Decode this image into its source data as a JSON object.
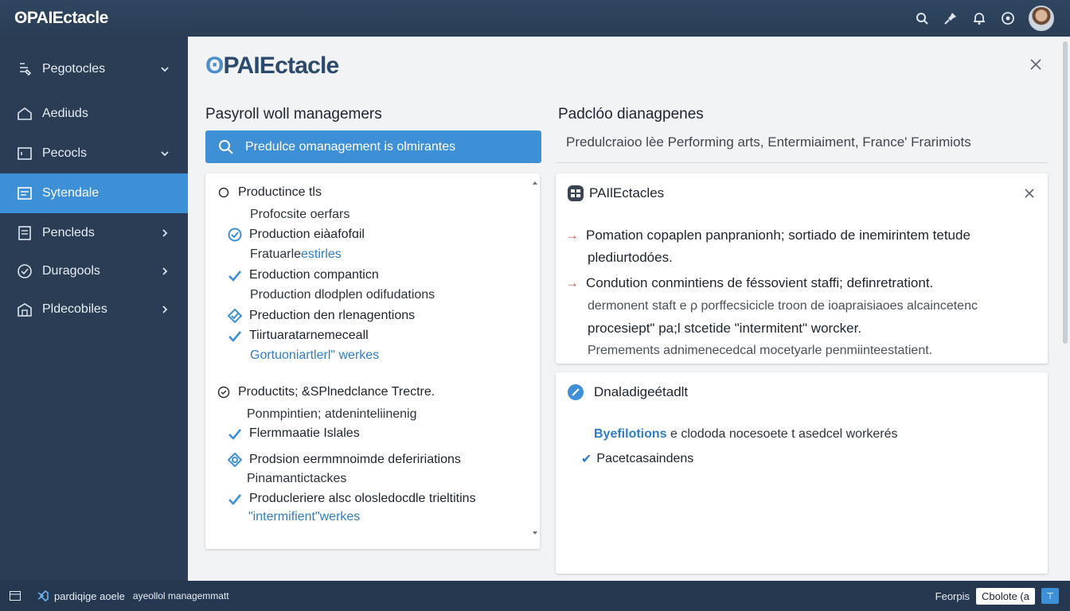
{
  "app": {
    "brand": "ʘPAIEctacle"
  },
  "colors": {
    "accent": "#3d8fd6",
    "sidebar": "#2a3d55",
    "topbar": "#2f4560",
    "alert_arrow": "#e0473c"
  },
  "topbar": {
    "icons": [
      "search-icon",
      "pin-icon",
      "bell-icon",
      "settings-icon",
      "avatar"
    ]
  },
  "sidebar": {
    "items": [
      {
        "label": "Pegotocles",
        "icon": "tools-icon",
        "chevron": "down"
      },
      {
        "label": "Aediuds",
        "icon": "home-icon",
        "chevron": ""
      },
      {
        "label": "Pecocls",
        "icon": "square-icon",
        "chevron": "down"
      },
      {
        "label": "Sytendale",
        "icon": "calendar-grid-icon",
        "chevron": "",
        "active": true
      },
      {
        "label": "Pencleds",
        "icon": "document-icon",
        "chevron": "right"
      },
      {
        "label": "Duragools",
        "icon": "check-circle-icon",
        "chevron": "right"
      },
      {
        "label": "Pldecobiles",
        "icon": "building-icon",
        "chevron": "right"
      }
    ]
  },
  "main": {
    "logo": "PAIEctacle",
    "left_title": "Pasyroll woll managemers",
    "search_text": "Predulce omanagement is olmirantes",
    "right_title": "Padclóo dianagpenes",
    "right_subtitle": "Predulcraioo lèe Performing arts, Entermiaiment, France' Frarimiots",
    "list": [
      {
        "text": "Productince tls",
        "icon": "radio-icon",
        "kind": "group"
      },
      {
        "text": "Profocsite oerfars",
        "kind": "sub"
      },
      {
        "text": "Production eiàafofɑil",
        "icon": "check-circle-icon",
        "kind": "item"
      },
      {
        "text_a": "Fratuarle ",
        "text_b": "estirles",
        "kind": "sub-mixed"
      },
      {
        "text": "Eroduction companticn",
        "icon": "check-icon",
        "kind": "item"
      },
      {
        "text": "Production dlodplen odifudations",
        "kind": "sub"
      },
      {
        "text": "Preduction den rlenagentions",
        "icon": "check-sparkle-icon",
        "kind": "item"
      },
      {
        "text": "Tiirtuaratarnemeceall",
        "icon": "check-icon",
        "kind": "item"
      },
      {
        "text": "Gortuoniartlerl\" werkes",
        "kind": "link"
      },
      {
        "text": "Productits; &SPlnedclance Trectre.",
        "icon": "radio-check-icon",
        "kind": "group"
      },
      {
        "text": "Ponmpintien; atdeninteliinenig",
        "kind": "sub"
      },
      {
        "text": "Flermmaatie Islales",
        "icon": "check-icon",
        "kind": "item"
      },
      {
        "text": "Prodsion eermmnoimde defeririations",
        "icon": "check-sparkle-icon",
        "kind": "item"
      },
      {
        "text": "Pinamantictackes",
        "kind": "sub"
      },
      {
        "text": "Producleriere alsc olosledocdle trieltitins",
        "icon": "check-icon",
        "kind": "item"
      },
      {
        "text": "\"intermifient\"werkes",
        "kind": "link"
      }
    ],
    "card1": {
      "title": "PAIlEctacles",
      "bullets": [
        "Pomation copaplen panpranionh; sortiado de inemirintem tetude",
        "Condution conmintiens de féssovient staffi; definretrationt."
      ],
      "lines": [
        "plediurtodóes.",
        "dermonent staft e ρ porffecsicicle troon de ioapraisiaoes alcaincetenc",
        "procesiept\" pa;l stcetide \"intermitent\" worcker.",
        "Premements adnimenecedcal mocetyarle penmiinteestatient."
      ]
    },
    "card2": {
      "title": "Dnaladigeétadlt",
      "line_a": "Byefilotions",
      "line_b": " e clododa nocesoete t asedcel workerés",
      "bullet": "Pacetcasaindens"
    }
  },
  "statusbar": {
    "left_label": "pardiqige aoele",
    "left_sub": "ayeollol managemmatt",
    "right_label": "Feorpis",
    "badge": "Cbolote (a",
    "square": "⊤"
  }
}
